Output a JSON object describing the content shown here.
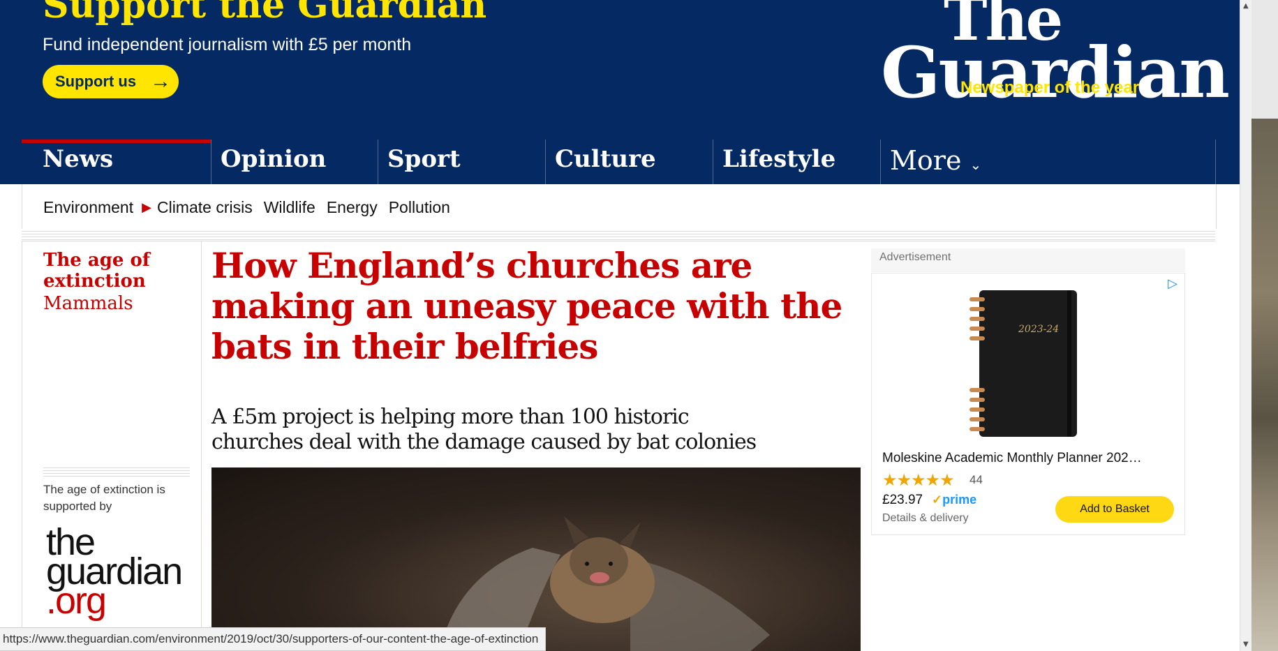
{
  "support": {
    "title": "Support the Guardian",
    "subtitle": "Fund independent journalism with £5 per month",
    "button_label": "Support us",
    "button_icon": "arrow-right-icon"
  },
  "logo": {
    "line1": "The",
    "line2": "Guardian",
    "tagline": "Newspaper of the year"
  },
  "nav": {
    "items": [
      {
        "label": "News",
        "active": true
      },
      {
        "label": "Opinion"
      },
      {
        "label": "Sport"
      },
      {
        "label": "Culture"
      },
      {
        "label": "Lifestyle"
      }
    ],
    "more_label": "More",
    "more_icon": "chevron-down-icon"
  },
  "subnav": {
    "items": [
      "Environment",
      "Climate crisis",
      "Wildlife",
      "Energy",
      "Pollution"
    ]
  },
  "series": {
    "name": "The age of extinction",
    "section": "Mammals",
    "supported_text": "The age of extinction is supported by",
    "supporter_logo": [
      "the",
      "guardian",
      ".org"
    ]
  },
  "article": {
    "headline": "How England’s churches are making an uneasy peace with the bats in their belfries",
    "standfirst": "A £5m project is helping more than 100 historic churches deal with the damage caused by bat colonies"
  },
  "ad": {
    "label": "Advertisement",
    "product_title": "Moleskine Academic Monthly Planner 202…",
    "planner_text": "2023-24",
    "stars": "★★★★★",
    "rating_count": "44",
    "price": "£23.97",
    "prime": "prime",
    "delivery": "Details & delivery",
    "button_label": "Add to Basket"
  },
  "status_bar": {
    "url": "https://www.theguardian.com/environment/2019/oct/30/supporters-of-our-content-the-age-of-extinction"
  },
  "colors": {
    "brand_blue": "#052962",
    "brand_yellow": "#ffe500",
    "news_red": "#c70000"
  }
}
